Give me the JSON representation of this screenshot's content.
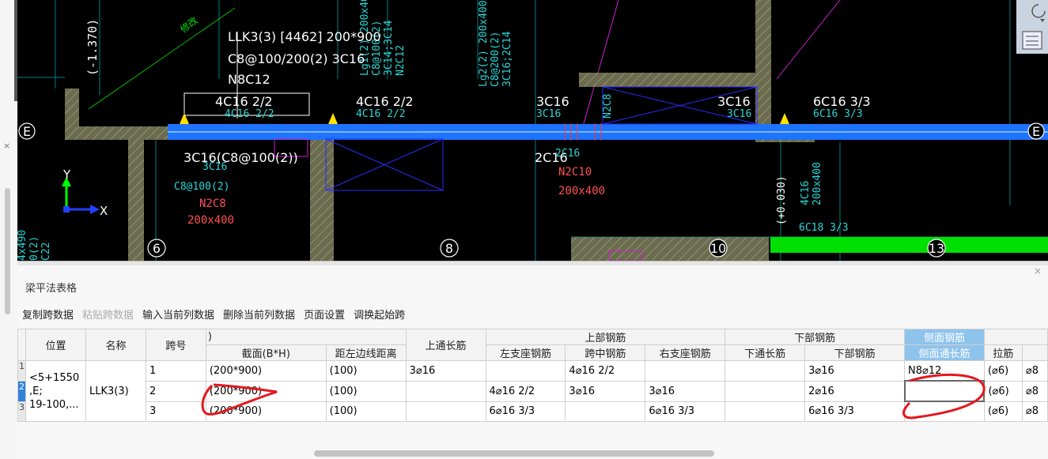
{
  "cad": {
    "axis_labels": [
      "E",
      "E",
      "6",
      "8",
      "10",
      "13"
    ],
    "coord_x": "X",
    "coord_y": "Y",
    "vtext": [
      "(-1.370)",
      "Lg1(2) 200x400",
      "C8@100(2)",
      "3C14;3C14",
      "N2C12",
      "Lg2(2) 200x400",
      "C8@200(2)",
      "3C16;2C14",
      "N2C8",
      "(+0.030)",
      "4C16",
      "200x400",
      "4x490",
      "0(2)",
      "C22"
    ],
    "texts": {
      "beam_title": "LLK3(3) [4462] 200*900",
      "beam_stirrup": "C8@100/200(2) 3C16",
      "beam_side": "N8C12",
      "top_left": "4C16 2/2",
      "top_left_cyan": "4C16 2/2",
      "top_mid_left": "4C16 2/2",
      "top_mid_left_cyan": "4C16 2/2",
      "top_mid": "3C16",
      "top_mid_cyan": "3C16",
      "top_right": "3C16",
      "top_right_cyan": "3C16",
      "top_far": "6C16 3/3",
      "top_far_cyan": "6C16 3/3",
      "bottom_left": "3C16(C8@100(2))",
      "bottom_left_cyan": "3C16",
      "c8_label": "C8@100(2)",
      "n2c8": "N2C8",
      "size1": "200x400",
      "bottom_mid": "2C16",
      "bottom_mid_cyan": "2C16",
      "n2c10": "N2C10",
      "size2": "200x400",
      "bottom_right": "6C18 3/3",
      "stamp": "修改"
    }
  },
  "panel": {
    "title": "梁平法表格",
    "close": "×",
    "toolbar": [
      "复制跨数据",
      "粘贴跨数据",
      "输入当前列数据",
      "删除当前列数据",
      "页面设置",
      "调换起始跨"
    ],
    "headers": {
      "location": "位置",
      "name": "名称",
      "span": "跨号",
      "elev_cut": ")",
      "section": "截面(B*H)",
      "edge_dist": "距左边线距离",
      "top_through": "上通长筋",
      "top_group": "上部钢筋",
      "top_left": "左支座钢筋",
      "top_mid": "跨中钢筋",
      "top_right": "右支座钢筋",
      "bottom_group": "下部钢筋",
      "bottom_through": "下通长筋",
      "bottom_bars": "下部钢筋",
      "side_group": "侧面钢筋",
      "side_through": "侧面通长筋",
      "tie": "拉筋"
    },
    "row_numbers": [
      "1",
      "2",
      "3"
    ],
    "location_value": "<5+1550,E;19-100,...",
    "location_lines": [
      "<5+1550",
      ",E;",
      "19-100,..."
    ],
    "name_value": "LLK3(3)",
    "rows": [
      {
        "span": "1",
        "section": "(200*900)",
        "dist": "(100)",
        "top_through": "3⌀16",
        "top_left": "",
        "top_mid": "4⌀16 2/2",
        "top_right": "",
        "bottom_through": "",
        "bottom": "3⌀16",
        "side": "N8⌀12",
        "tie": "(⌀6)",
        "extra": "⌀8"
      },
      {
        "span": "2",
        "section": "(200*900)",
        "dist": "(100)",
        "top_through": "",
        "top_left": "4⌀16 2/2",
        "top_mid": "3⌀16",
        "top_right": "3⌀16",
        "bottom_through": "",
        "bottom": "2⌀16",
        "side": "",
        "tie": "(⌀6)",
        "extra": "⌀8"
      },
      {
        "span": "3",
        "section": "(200*900)",
        "dist": "(100)",
        "top_through": "",
        "top_left": "6⌀16 3/3",
        "top_mid": "",
        "top_right": "6⌀16 3/3",
        "bottom_through": "",
        "bottom": "6⌀16 3/3",
        "side": "",
        "tie": "(⌀6)",
        "extra": "⌀8"
      }
    ]
  },
  "colors": {
    "cad_bg": "#000000",
    "beam": "#1e73ff",
    "wall": "#00a0a0",
    "annotation": "#e3171e",
    "select": "#2f82d8"
  }
}
